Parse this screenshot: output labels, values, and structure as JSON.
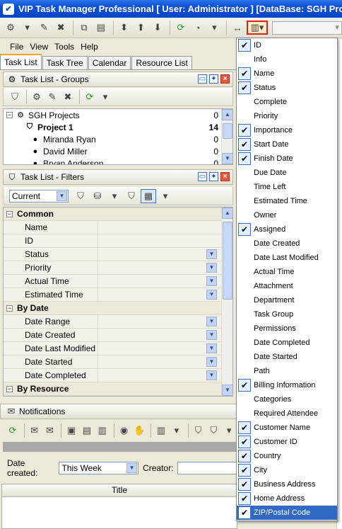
{
  "window": {
    "title": "VIP Task Manager Professional [ User: Administrator ] [DataBase: SGH Projects]"
  },
  "menubar": {
    "file": "File",
    "view": "View",
    "tools": "Tools",
    "help": "Help"
  },
  "tabs": [
    "Task List",
    "Task Tree",
    "Calendar",
    "Resource List"
  ],
  "groups_panel": {
    "title": "Task List - Groups",
    "rows": [
      {
        "label": "SGH Projects",
        "count": "0"
      },
      {
        "label": "Project 1",
        "count": "14"
      },
      {
        "label": "Miranda Ryan",
        "count": "0"
      },
      {
        "label": "David Miller",
        "count": "0"
      },
      {
        "label": "Bryan Anderson",
        "count": "0"
      }
    ]
  },
  "filters_panel": {
    "title": "Task List - Filters",
    "current": "Current",
    "categories": [
      {
        "name": "Common",
        "fields": [
          "Name",
          "ID",
          "Status",
          "Priority",
          "Actual Time",
          "Estimated Time"
        ]
      },
      {
        "name": "By Date",
        "fields": [
          "Date Range",
          "Date Created",
          "Date Last Modified",
          "Date Started",
          "Date Completed"
        ]
      },
      {
        "name": "By Resource",
        "fields": []
      }
    ]
  },
  "notifications": {
    "title": "Notifications",
    "date_created_label": "Date created:",
    "date_created_value": "This Week",
    "creator_label": "Creator:",
    "column_title": "Title"
  },
  "column_menu": {
    "items": [
      {
        "label": "ID",
        "checked": true
      },
      {
        "label": "Info",
        "checked": false
      },
      {
        "label": "Name",
        "checked": true
      },
      {
        "label": "Status",
        "checked": true
      },
      {
        "label": "Complete",
        "checked": false
      },
      {
        "label": "Priority",
        "checked": false
      },
      {
        "label": "Importance",
        "checked": true
      },
      {
        "label": "Start Date",
        "checked": true
      },
      {
        "label": "Finish Date",
        "checked": true
      },
      {
        "label": "Due Date",
        "checked": false
      },
      {
        "label": "Time Left",
        "checked": false
      },
      {
        "label": "Estimated Time",
        "checked": false
      },
      {
        "label": "Owner",
        "checked": false
      },
      {
        "label": "Assigned",
        "checked": true
      },
      {
        "label": "Date Created",
        "checked": false
      },
      {
        "label": "Date Last Modified",
        "checked": false
      },
      {
        "label": "Actual Time",
        "checked": false
      },
      {
        "label": "Attachment",
        "checked": false
      },
      {
        "label": "Department",
        "checked": false
      },
      {
        "label": "Task Group",
        "checked": false
      },
      {
        "label": "Permissions",
        "checked": false
      },
      {
        "label": "Date Completed",
        "checked": false
      },
      {
        "label": "Date Started",
        "checked": false
      },
      {
        "label": "Path",
        "checked": false
      },
      {
        "label": "Billing Information",
        "checked": true
      },
      {
        "label": "Categories",
        "checked": false
      },
      {
        "label": "Required Attendee",
        "checked": false
      },
      {
        "label": "Customer Name",
        "checked": true
      },
      {
        "label": "Customer ID",
        "checked": true
      },
      {
        "label": "Country",
        "checked": true
      },
      {
        "label": "City",
        "checked": true
      },
      {
        "label": "Business Address",
        "checked": true
      },
      {
        "label": "Home Address",
        "checked": true
      },
      {
        "label": "ZIP/Postal Code",
        "checked": true,
        "highlighted": true
      }
    ]
  },
  "colors": {
    "title_bar": "#0a4fd6",
    "highlight": "#316ac5",
    "active_button_border": "#e02020"
  }
}
